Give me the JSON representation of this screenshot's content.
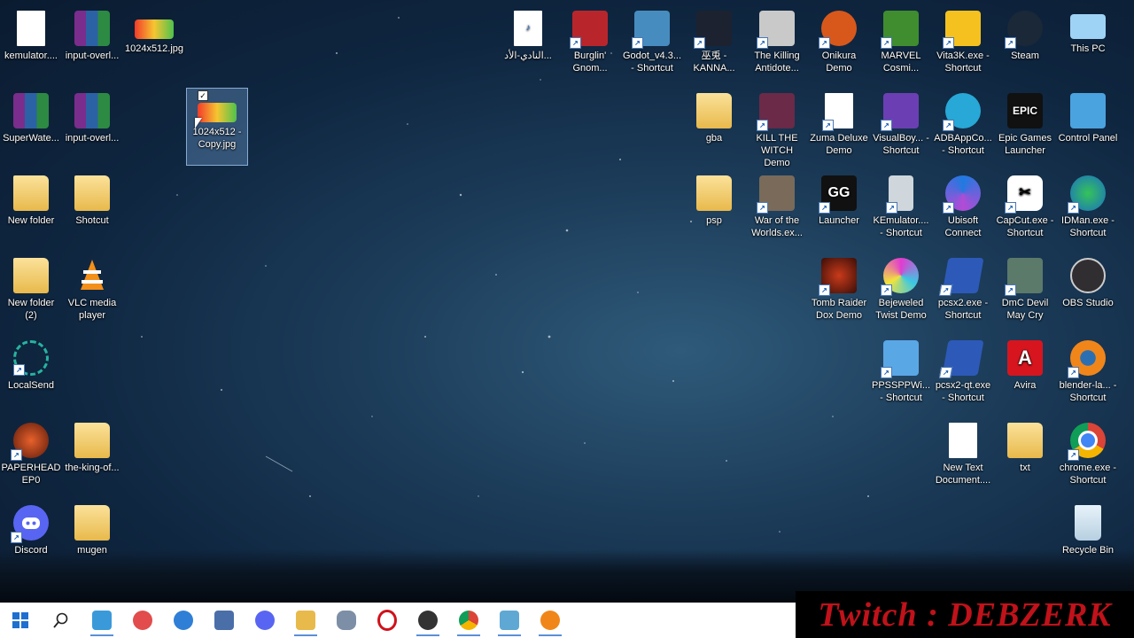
{
  "desktop": {
    "icons": [
      {
        "id": "kemulator",
        "label": "kemulator....",
        "icon": "doc-icon"
      },
      {
        "id": "input-overlay-1",
        "label": "input-overl...",
        "icon": "winrar-icon"
      },
      {
        "id": "img-1024",
        "label": "1024x512.jpg",
        "icon": "image-icon"
      },
      {
        "id": "superwater",
        "label": "SuperWate...",
        "icon": "winrar-icon"
      },
      {
        "id": "input-overlay-2",
        "label": "input-overl...",
        "icon": "winrar-icon"
      },
      {
        "id": "img-1024-copy",
        "label": "1024x512 - Copy.jpg",
        "icon": "image-icon",
        "selected": true
      },
      {
        "id": "new-folder",
        "label": "New folder",
        "icon": "folder-icon"
      },
      {
        "id": "shotcut",
        "label": "Shotcut",
        "icon": "folder-icon"
      },
      {
        "id": "new-folder-2",
        "label": "New folder (2)",
        "icon": "folder-icon"
      },
      {
        "id": "vlc",
        "label": "VLC media player",
        "icon": "vlc-icon"
      },
      {
        "id": "localsend",
        "label": "LocalSend",
        "icon": "localsend-icon"
      },
      {
        "id": "paperhead",
        "label": "PAPERHEAD EP0",
        "icon": "paperhead-icon"
      },
      {
        "id": "king-of",
        "label": "the-king-of...",
        "icon": "folder-icon"
      },
      {
        "id": "discord",
        "label": "Discord",
        "icon": "discord-icon"
      },
      {
        "id": "mugen",
        "label": "mugen",
        "icon": "folder-icon"
      },
      {
        "id": "mp3",
        "label": "النادي-الأد...",
        "icon": "mp3-icon"
      },
      {
        "id": "burglin",
        "label": "Burglin' Gnom...",
        "icon": "burglin-icon"
      },
      {
        "id": "godot",
        "label": "Godot_v4.3... - Shortcut",
        "icon": "godot-icon"
      },
      {
        "id": "kanna",
        "label": "巫兎 - KANNA...",
        "icon": "kanna-icon"
      },
      {
        "id": "killing-antidote",
        "label": "The Killing Antidote...",
        "icon": "game-icon"
      },
      {
        "id": "onikura",
        "label": "Onikura Demo",
        "icon": "game-icon"
      },
      {
        "id": "marvel",
        "label": "MARVEL Cosmi...",
        "icon": "marvel-icon"
      },
      {
        "id": "vita3k",
        "label": "Vita3K.exe - Shortcut",
        "icon": "vita3k-icon"
      },
      {
        "id": "steam",
        "label": "Steam",
        "icon": "steam-icon"
      },
      {
        "id": "this-pc",
        "label": "This PC",
        "icon": "computer-icon"
      },
      {
        "id": "gba",
        "label": "gba",
        "icon": "folder-icon"
      },
      {
        "id": "kill-witch",
        "label": "KILL THE WITCH Demo",
        "icon": "game-icon"
      },
      {
        "id": "zuma",
        "label": "Zuma Deluxe Demo",
        "icon": "doc-icon"
      },
      {
        "id": "visualboy",
        "label": "VisualBoy... - Shortcut",
        "icon": "gameboy-icon"
      },
      {
        "id": "adbapp",
        "label": "ADBAppCo... - Shortcut",
        "icon": "android-icon"
      },
      {
        "id": "epic",
        "label": "Epic Games Launcher",
        "icon": "epic-icon"
      },
      {
        "id": "control-panel",
        "label": "Control Panel",
        "icon": "control-panel-icon"
      },
      {
        "id": "psp",
        "label": "psp",
        "icon": "folder-icon"
      },
      {
        "id": "war-worlds",
        "label": "War of the Worlds.ex...",
        "icon": "game-icon"
      },
      {
        "id": "launcher",
        "label": "Launcher",
        "icon": "launcher-icon"
      },
      {
        "id": "kemulator-sc",
        "label": "KEmulator.... - Shortcut",
        "icon": "phone-icon"
      },
      {
        "id": "ubisoft",
        "label": "Ubisoft Connect",
        "icon": "ubisoft-icon"
      },
      {
        "id": "capcut",
        "label": "CapCut.exe - Shortcut",
        "icon": "capcut-icon"
      },
      {
        "id": "idman",
        "label": "IDMan.exe - Shortcut",
        "icon": "idm-icon"
      },
      {
        "id": "tomb-raider",
        "label": "Tomb Raider Dox Demo",
        "icon": "game-icon"
      },
      {
        "id": "bejeweled",
        "label": "Bejeweled Twist Demo",
        "icon": "gem-icon"
      },
      {
        "id": "pcsx2",
        "label": "pcsx2.exe - Shortcut",
        "icon": "pcsx2-icon"
      },
      {
        "id": "dmc",
        "label": "DmC Devil May Cry",
        "icon": "game-icon"
      },
      {
        "id": "obs",
        "label": "OBS Studio",
        "icon": "obs-icon"
      },
      {
        "id": "ppsspp",
        "label": "PPSSPPWi... - Shortcut",
        "icon": "ppsspp-icon"
      },
      {
        "id": "pcsx2-qt",
        "label": "pcsx2-qt.exe - Shortcut",
        "icon": "pcsx2-icon"
      },
      {
        "id": "avira",
        "label": "Avira",
        "icon": "avira-icon"
      },
      {
        "id": "blender",
        "label": "blender-la... - Shortcut",
        "icon": "blender-icon"
      },
      {
        "id": "new-text",
        "label": "New Text Document....",
        "icon": "text-doc-icon"
      },
      {
        "id": "txt",
        "label": "txt",
        "icon": "folder-icon"
      },
      {
        "id": "chrome",
        "label": "chrome.exe - Shortcut",
        "icon": "chrome-icon"
      },
      {
        "id": "recycle",
        "label": "Recycle Bin",
        "icon": "recycle-bin-icon"
      }
    ]
  },
  "taskbar": {
    "items": [
      {
        "id": "start",
        "icon": "windows-start-icon",
        "color": "#1e6fd0"
      },
      {
        "id": "search",
        "icon": "search-icon",
        "color": "#222222"
      },
      {
        "id": "app-1",
        "icon": "fish-app-icon",
        "color": "#3a9ad9"
      },
      {
        "id": "app-mic",
        "icon": "microphone-icon",
        "color": "#e24c4c"
      },
      {
        "id": "app-broadcast",
        "icon": "broadcast-icon",
        "color": "#2f7fd6"
      },
      {
        "id": "app-explorer-doc",
        "icon": "document-app-icon",
        "color": "#4a6ea8"
      },
      {
        "id": "app-discord",
        "icon": "discord-icon",
        "color": "#5865f2"
      },
      {
        "id": "app-files",
        "icon": "file-explorer-icon",
        "color": "#e8b94b"
      },
      {
        "id": "app-gamepad",
        "icon": "gamepad-icon",
        "color": "#7d8fa6"
      },
      {
        "id": "app-opera",
        "icon": "opera-icon",
        "color": "#d0111b"
      },
      {
        "id": "app-obs",
        "icon": "obs-icon",
        "color": "#333333"
      },
      {
        "id": "app-chrome",
        "icon": "chrome-icon",
        "color": "#1a73e8"
      },
      {
        "id": "app-notepad",
        "icon": "notepad-icon",
        "color": "#5fa8d3"
      },
      {
        "id": "app-blender",
        "icon": "blender-icon",
        "color": "#f0861a"
      }
    ]
  },
  "overlay": {
    "text": "Twitch : DEBZERK"
  }
}
